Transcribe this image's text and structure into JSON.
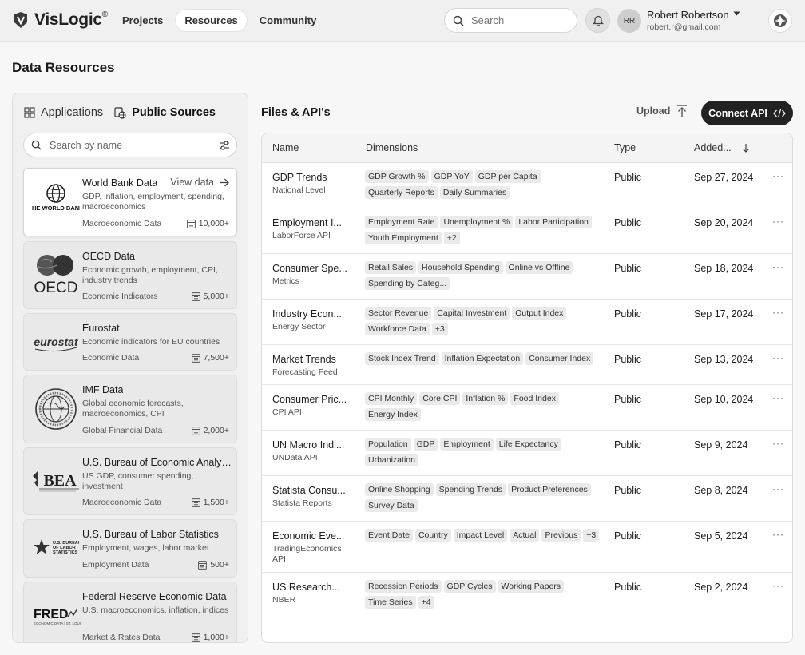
{
  "app": {
    "name": "VisLogic",
    "trademark": "©"
  },
  "nav": [
    {
      "label": "Projects",
      "active": false
    },
    {
      "label": "Resources",
      "active": true
    },
    {
      "label": "Community",
      "active": false
    }
  ],
  "header": {
    "search_placeholder": "Search"
  },
  "user": {
    "initials": "RR",
    "name": "Robert Robertson",
    "email": "robert.r@gmail.com"
  },
  "page": {
    "title": "Data Resources"
  },
  "left": {
    "tabs": [
      {
        "label": "Applications",
        "icon": "apps-icon",
        "active": false
      },
      {
        "label": "Public Sources",
        "icon": "globe-icon",
        "active": true
      }
    ],
    "search_placeholder": "Search by name",
    "view_data_label": "View data",
    "sources": [
      {
        "name": "World Bank Data",
        "desc": "GDP, inflation, employment, spending, macroeconomics",
        "category": "Macroeconomic Data",
        "count": "10,000+",
        "logo": "THE WORLD BANK",
        "selected": true
      },
      {
        "name": "OECD Data",
        "desc": "Economic growth, employment, CPI, industry trends",
        "category": "Economic Indicators",
        "count": "5,000+",
        "logo": "OECD",
        "selected": false
      },
      {
        "name": "Eurostat",
        "desc": "Economic indicators for EU countries",
        "category": "Economic Data",
        "count": "7,500+",
        "logo": "eurostat",
        "selected": false
      },
      {
        "name": "IMF Data",
        "desc": "Global economic forecasts, macroeconomics, CPI",
        "category": "Global Financial Data",
        "count": "2,000+",
        "logo": "INTERNATIONAL MONETARY FUND",
        "selected": false
      },
      {
        "name": "U.S. Bureau of Economic Analysis",
        "desc": "US GDP, consumer spending, investment",
        "category": "Macroeconomic Data",
        "count": "1,500+",
        "logo": "BEA",
        "selected": false
      },
      {
        "name": "U.S. Bureau of Labor Statistics",
        "desc": "Employment, wages, labor market",
        "category": "Employment Data",
        "count": "500+",
        "logo": "U.S. BUREAU OF LABOR STATISTICS",
        "selected": false
      },
      {
        "name": "Federal Reserve Economic Data",
        "desc": "U.S. macroeconomics, inflation, indices",
        "category": "Market & Rates Data",
        "count": "1,000+",
        "logo": "FRED",
        "selected": false
      }
    ]
  },
  "files": {
    "title": "Files & API's",
    "upload_label": "Upload",
    "connect_label": "Connect API",
    "columns": {
      "name": "Name",
      "dimensions": "Dimensions",
      "type": "Type",
      "added": "Added..."
    },
    "rows": [
      {
        "name": "GDP Trends",
        "sub": "National Level",
        "dims": [
          "GDP Growth %",
          "GDP YoY",
          "GDP per Capita",
          "Quarterly Reports",
          "Daily Summaries"
        ],
        "type": "Public",
        "date": "Sep 27, 2024"
      },
      {
        "name": "Employment I...",
        "sub": "LaborForce API",
        "dims": [
          "Employment Rate",
          "Unemployment %",
          "Labor Participation",
          "Youth Employment",
          "+2"
        ],
        "type": "Public",
        "date": "Sep 20, 2024"
      },
      {
        "name": "Consumer Spe...",
        "sub": "Metrics",
        "dims": [
          "Retail Sales",
          "Household Spending",
          "Online vs Offline",
          "Spending by Categ..."
        ],
        "type": "Public",
        "date": "Sep 18, 2024"
      },
      {
        "name": "Industry Econ...",
        "sub": "Energy Sector",
        "dims": [
          "Sector Revenue",
          "Capital Investment",
          "Output Index",
          "Workforce Data",
          "+3"
        ],
        "type": "Public",
        "date": "Sep 17, 2024"
      },
      {
        "name": "Market Trends",
        "sub": "Forecasting Feed",
        "dims": [
          "Stock Index Trend",
          "Inflation Expectation",
          "Consumer Index"
        ],
        "type": "Public",
        "date": "Sep 13, 2024"
      },
      {
        "name": "Consumer Pric...",
        "sub": "CPI API",
        "dims": [
          "CPI Monthly",
          "Core CPI",
          "Inflation %",
          "Food Index",
          "Energy Index"
        ],
        "type": "Public",
        "date": "Sep 10, 2024"
      },
      {
        "name": "UN Macro Indi...",
        "sub": "UNData API",
        "dims": [
          "Population",
          "GDP",
          "Employment",
          "Life Expectancy",
          "Urbanization"
        ],
        "type": "Public",
        "date": "Sep 9, 2024"
      },
      {
        "name": "Statista Consu...",
        "sub": "Statista Reports",
        "dims": [
          "Online Shopping",
          "Spending Trends",
          "Product Preferences",
          "Survey Data"
        ],
        "type": "Public",
        "date": "Sep 8, 2024"
      },
      {
        "name": "Economic Eve...",
        "sub": "TradingEconomics API",
        "dims": [
          "Event Date",
          "Country",
          "Impact Level",
          "Actual",
          "Previous",
          "+3"
        ],
        "type": "Public",
        "date": "Sep 5, 2024"
      },
      {
        "name": "US Research...",
        "sub": "NBER",
        "dims": [
          "Recession Periods",
          "GDP Cycles",
          "Working Papers",
          "Time Series",
          "+4"
        ],
        "type": "Public",
        "date": "Sep 2, 2024"
      }
    ]
  }
}
